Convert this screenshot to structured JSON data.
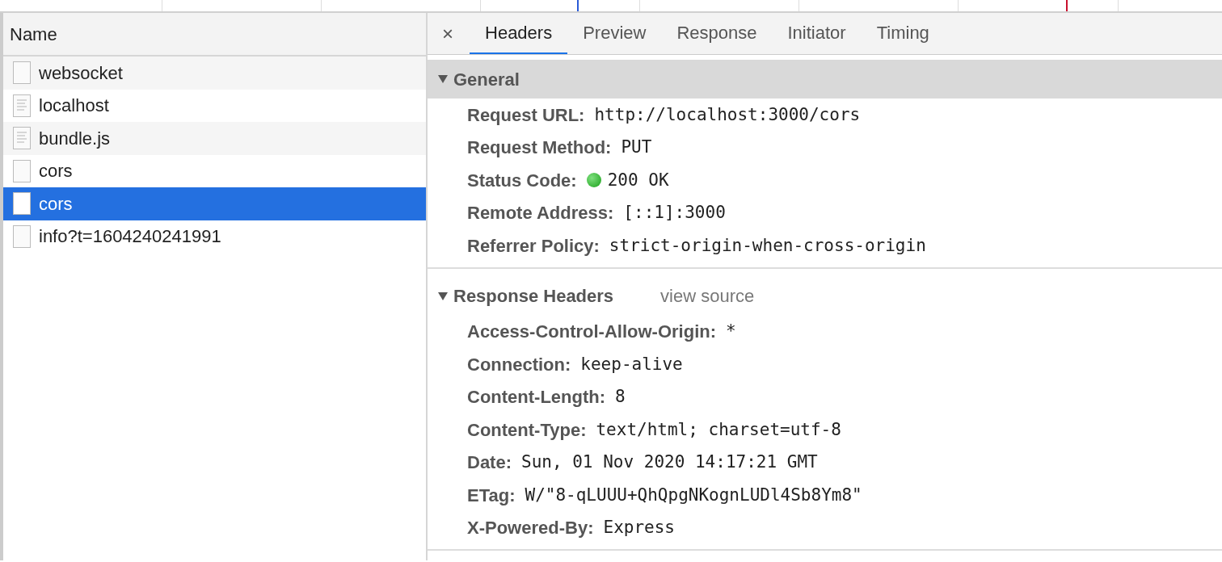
{
  "request_list": {
    "column": "Name",
    "rows": [
      {
        "name": "websocket",
        "kind": "blank",
        "selected": false
      },
      {
        "name": "localhost",
        "kind": "document",
        "selected": false
      },
      {
        "name": "bundle.js",
        "kind": "document",
        "selected": false
      },
      {
        "name": "cors",
        "kind": "blank",
        "selected": false
      },
      {
        "name": "cors",
        "kind": "blank",
        "selected": true
      },
      {
        "name": "info?t=1604240241991",
        "kind": "blank",
        "selected": false
      }
    ]
  },
  "detail": {
    "close": "×",
    "tabs": [
      {
        "label": "Headers",
        "selected": true
      },
      {
        "label": "Preview",
        "selected": false
      },
      {
        "label": "Response",
        "selected": false
      },
      {
        "label": "Initiator",
        "selected": false
      },
      {
        "label": "Timing",
        "selected": false
      }
    ],
    "sections": [
      {
        "title": "General",
        "expanded": true,
        "highlighted": true,
        "rows": [
          {
            "key": "Request URL:",
            "value": "http://localhost:3000/cors"
          },
          {
            "key": "Request Method:",
            "value": "PUT"
          },
          {
            "key": "Status Code:",
            "value": "200 OK",
            "kind": "status"
          },
          {
            "key": "Remote Address:",
            "value": "[::1]:3000"
          },
          {
            "key": "Referrer Policy:",
            "value": "strict-origin-when-cross-origin"
          }
        ]
      },
      {
        "title": "Response Headers",
        "link": "view source",
        "expanded": true,
        "highlighted": false,
        "rows": [
          {
            "key": "Access-Control-Allow-Origin:",
            "value": "*"
          },
          {
            "key": "Connection:",
            "value": "keep-alive"
          },
          {
            "key": "Content-Length:",
            "value": "8"
          },
          {
            "key": "Content-Type:",
            "value": "text/html; charset=utf-8"
          },
          {
            "key": "Date:",
            "value": "Sun, 01 Nov 2020 14:17:21 GMT"
          },
          {
            "key": "ETag:",
            "value": "W/\"8-qLUUU+QhQpgNKognLUDl4Sb8Ym8\""
          },
          {
            "key": "X-Powered-By:",
            "value": "Express"
          }
        ]
      }
    ]
  }
}
